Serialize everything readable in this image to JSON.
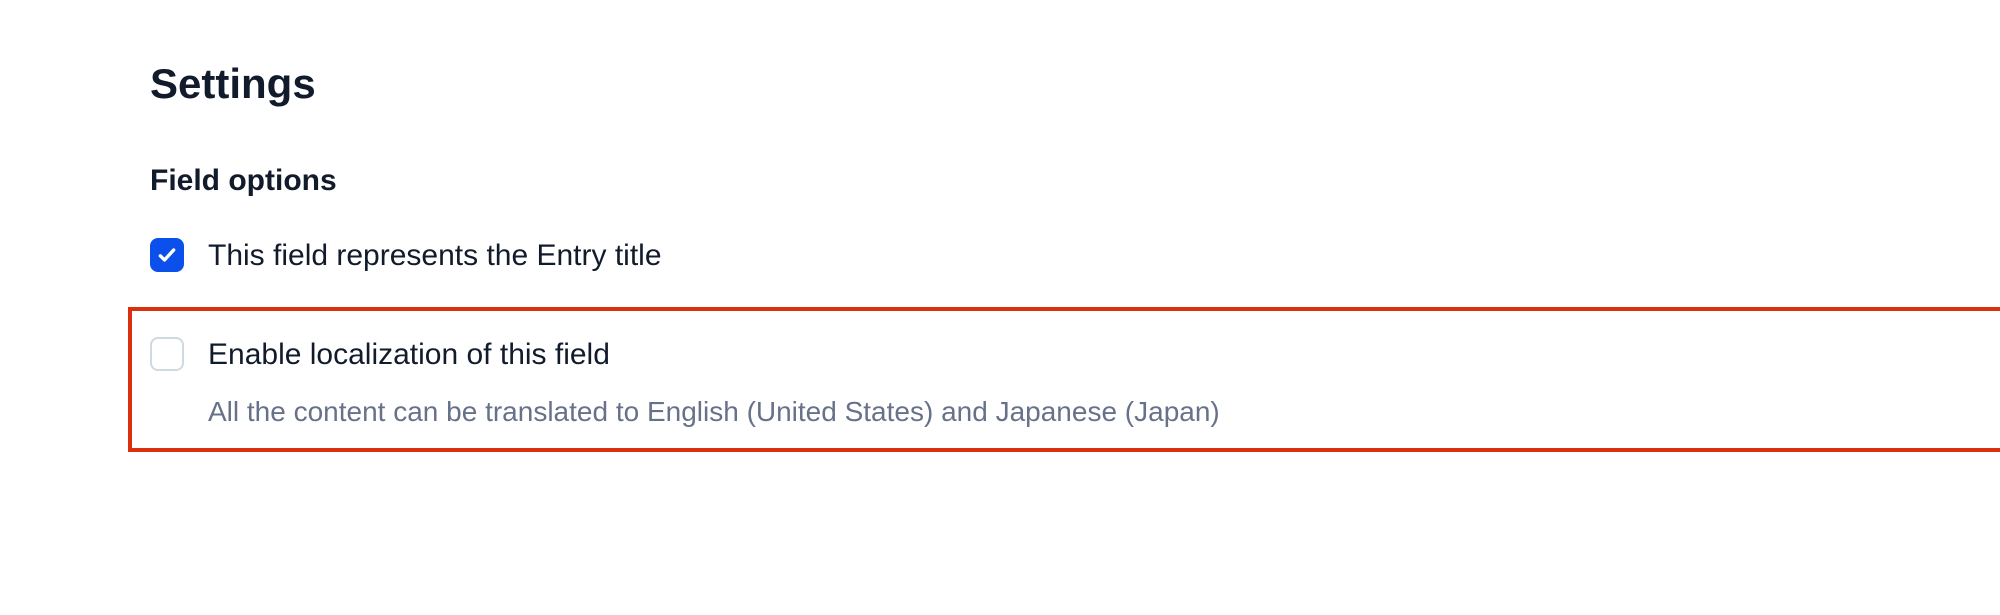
{
  "headings": {
    "settings": "Settings",
    "field_options": "Field options"
  },
  "options": {
    "entry_title": {
      "label": "This field represents the Entry title",
      "checked": true
    },
    "localization": {
      "label": "Enable localization of this field",
      "description": "All the content can be translated to English (United States) and Japanese (Japan)",
      "checked": false
    }
  }
}
